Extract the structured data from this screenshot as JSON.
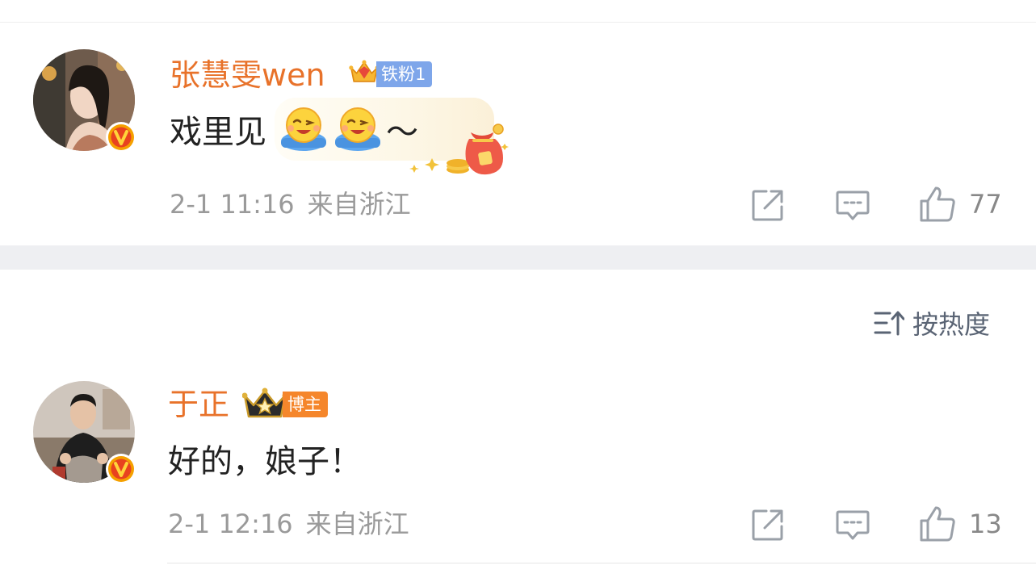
{
  "comments": [
    {
      "username": "张慧雯wen",
      "badge_label": "铁粉1",
      "badge_color": "#7ea6ea",
      "text": "戏里见",
      "text_suffix": "～",
      "emojis": [
        "wink-hands-emoji",
        "wink-hands-emoji"
      ],
      "time": "2-1 11:16",
      "location": "来自浙江",
      "like_count": "77"
    },
    {
      "username": "于正",
      "badge_label": "博主",
      "badge_color": "#f5862b",
      "text": "好的，娘子！",
      "time": "2-1 12:16",
      "location": "来自浙江",
      "like_count": "13"
    }
  ],
  "sort": {
    "label": "按热度",
    "icon": "sort-icon"
  },
  "colors": {
    "username": "#e8722a",
    "verified_badge": "#f5a000",
    "meta_text": "#9a9a9a",
    "separator": "#eeeff2"
  }
}
